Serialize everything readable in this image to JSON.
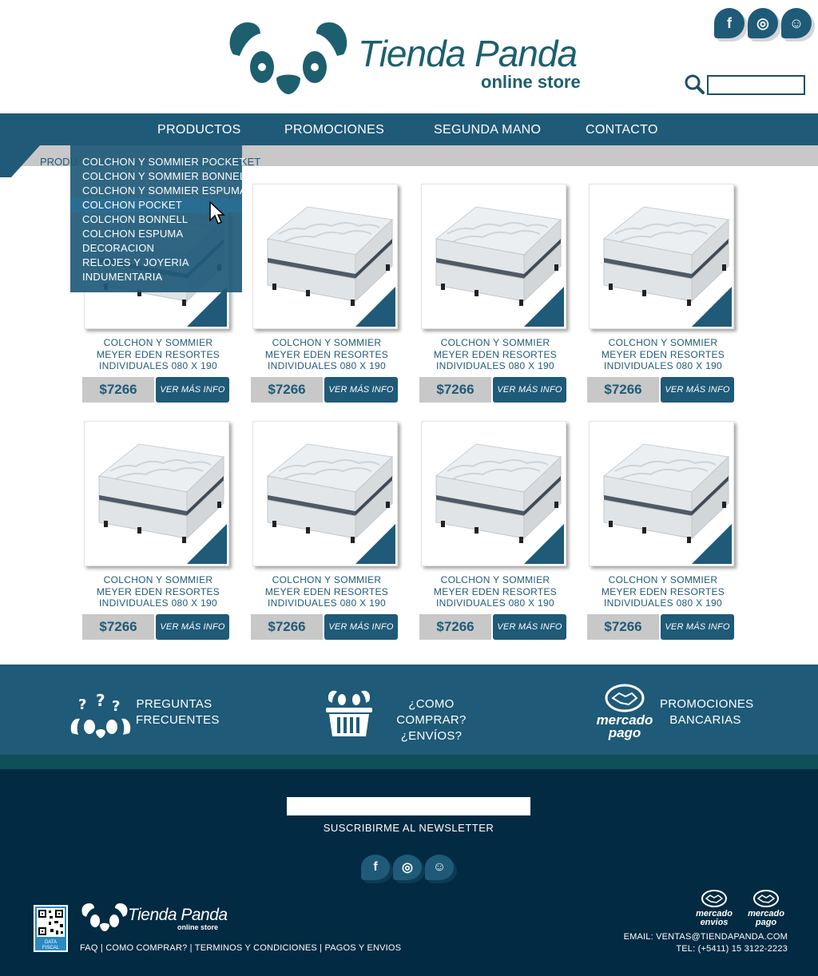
{
  "brand": {
    "name": "Tienda Panda",
    "tagline": "online store",
    "primary_color": "#1f5a78",
    "footer_color": "#022a42",
    "accent_gray": "#c8c8c8"
  },
  "header": {
    "social": [
      {
        "icon": "facebook-icon",
        "glyph": "f"
      },
      {
        "icon": "instagram-icon",
        "glyph": "◎"
      },
      {
        "icon": "snapchat-icon",
        "glyph": "☺"
      }
    ],
    "search": {
      "value": "",
      "placeholder": ""
    }
  },
  "nav": {
    "items": [
      {
        "label": "PRODUCTOS"
      },
      {
        "label": "PROMOCIONES"
      },
      {
        "label": "SEGUNDA MANO"
      },
      {
        "label": "CONTACTO"
      }
    ]
  },
  "breadcrumb": {
    "prefix": "PRODU",
    "suffix": "KET"
  },
  "dropdown": {
    "items": [
      {
        "label": "COLCHON Y SOMMIER POCKET",
        "active": false
      },
      {
        "label": "COLCHON Y SOMMIER BONNELL",
        "active": false
      },
      {
        "label": "COLCHON Y SOMMIER ESPUMA",
        "active": false
      },
      {
        "label": "COLCHON POCKET",
        "active": true
      },
      {
        "label": "COLCHON BONNELL",
        "active": false
      },
      {
        "label": "COLCHON ESPUMA",
        "active": false
      },
      {
        "label": "DECORACION",
        "active": false
      },
      {
        "label": "RELOJES Y JOYERIA",
        "active": false
      },
      {
        "label": "INDUMENTARIA",
        "active": false
      }
    ]
  },
  "products": [
    {
      "name_l1": "COLCHON Y SOMMIER",
      "name_l2": "MEYER EDEN RESORTES",
      "name_l3": "INDIVIDUALES 080 X 190",
      "price": "$7266",
      "more": "VER MÁS INFO"
    },
    {
      "name_l1": "COLCHON Y SOMMIER",
      "name_l2": "MEYER EDEN RESORTES",
      "name_l3": "INDIVIDUALES 080 X 190",
      "price": "$7266",
      "more": "VER MÁS INFO"
    },
    {
      "name_l1": "COLCHON Y SOMMIER",
      "name_l2": "MEYER EDEN RESORTES",
      "name_l3": "INDIVIDUALES 080 X 190",
      "price": "$7266",
      "more": "VER MÁS INFO"
    },
    {
      "name_l1": "COLCHON Y SOMMIER",
      "name_l2": "MEYER EDEN RESORTES",
      "name_l3": "INDIVIDUALES 080 X 190",
      "price": "$7266",
      "more": "VER MÁS INFO"
    },
    {
      "name_l1": "COLCHON Y SOMMIER",
      "name_l2": "MEYER EDEN RESORTES",
      "name_l3": "INDIVIDUALES 080 X 190",
      "price": "$7266",
      "more": "VER MÁS INFO"
    },
    {
      "name_l1": "COLCHON Y SOMMIER",
      "name_l2": "MEYER EDEN RESORTES",
      "name_l3": "INDIVIDUALES 080 X 190",
      "price": "$7266",
      "more": "VER MÁS INFO"
    },
    {
      "name_l1": "COLCHON Y SOMMIER",
      "name_l2": "MEYER EDEN RESORTES",
      "name_l3": "INDIVIDUALES 080 X 190",
      "price": "$7266",
      "more": "VER MÁS INFO"
    },
    {
      "name_l1": "COLCHON Y SOMMIER",
      "name_l2": "MEYER EDEN RESORTES",
      "name_l3": "INDIVIDUALES 080 X 190",
      "price": "$7266",
      "more": "VER MÁS INFO"
    }
  ],
  "info": {
    "faq_l1": "PREGUNTAS",
    "faq_l2": "FRECUENTES",
    "buy_l1": "¿COMO COMPRAR?",
    "buy_l2": "¿ENVÍOS?",
    "promo_l1": "PROMOCIONES",
    "promo_l2": "BANCARIAS",
    "mp_l1": "mercado",
    "mp_l2": "pago"
  },
  "footer": {
    "newsletter_label": "SUSCRIBIRME AL NEWSLETTER",
    "newsletter_value": "",
    "qr_caption_l1": "DATA",
    "qr_caption_l2": "FISCAL",
    "links": [
      "FAQ",
      "COMO COMPRAR?",
      "TERMINOS Y CONDICIONES",
      "PAGOS Y ENVIOS"
    ],
    "separator": " | ",
    "mercado_envios_l1": "mercado",
    "mercado_envios_l2": "envios",
    "mercado_pago_l1": "mercado",
    "mercado_pago_l2": "pago",
    "email": "EMAIL: VENTAS@TIENDAPANDA.COM",
    "phone": "TEL: (+5411) 15 3122-2223"
  }
}
